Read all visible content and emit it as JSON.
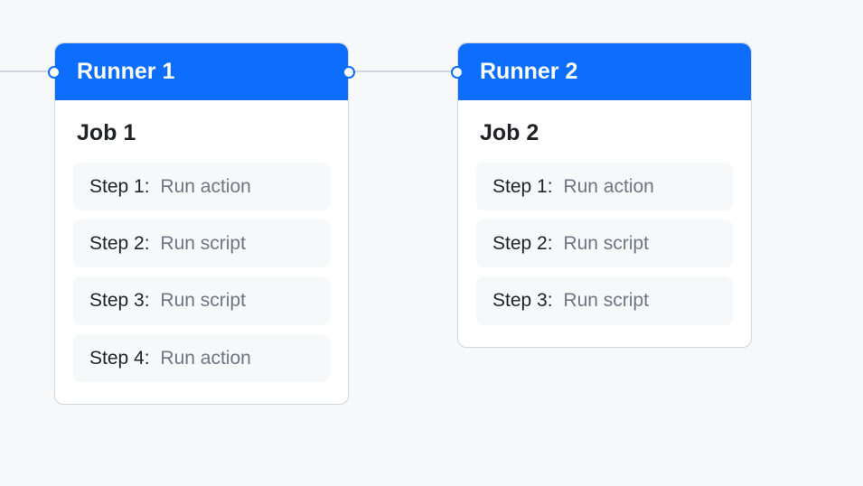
{
  "runners": [
    {
      "title": "Runner 1",
      "job": "Job 1",
      "hasLeftPort": true,
      "hasRightPort": true,
      "steps": [
        {
          "label": "Step 1:",
          "desc": "Run action"
        },
        {
          "label": "Step 2:",
          "desc": "Run script"
        },
        {
          "label": "Step 3:",
          "desc": "Run script"
        },
        {
          "label": "Step 4:",
          "desc": "Run action"
        }
      ]
    },
    {
      "title": "Runner 2",
      "job": "Job 2",
      "hasLeftPort": true,
      "hasRightPort": false,
      "steps": [
        {
          "label": "Step 1:",
          "desc": "Run action"
        },
        {
          "label": "Step 2:",
          "desc": "Run script"
        },
        {
          "label": "Step 3:",
          "desc": "Run script"
        }
      ]
    }
  ]
}
